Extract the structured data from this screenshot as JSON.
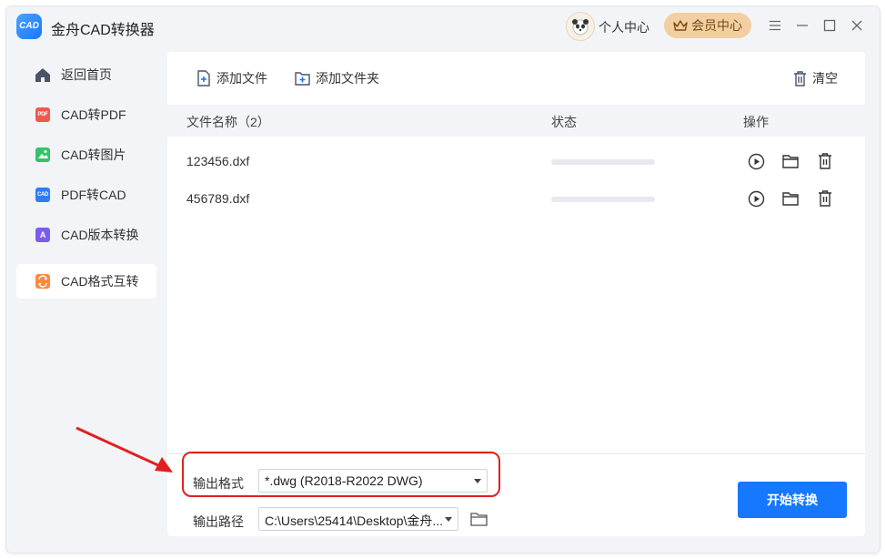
{
  "app": {
    "logo_text": "CAD",
    "title": "金舟CAD转换器"
  },
  "header": {
    "user_center": "个人中心",
    "vip_center": "会员中心"
  },
  "sidebar": {
    "items": [
      {
        "label": "返回首页",
        "icon": "home-icon"
      },
      {
        "label": "CAD转PDF",
        "icon": "pdf-icon",
        "badge": "PDF",
        "color": "#f0594f"
      },
      {
        "label": "CAD转图片",
        "icon": "image-icon",
        "color": "#36c26b"
      },
      {
        "label": "PDF转CAD",
        "icon": "cad-icon",
        "badge": "CAD",
        "color": "#2d7df6"
      },
      {
        "label": "CAD版本转换",
        "icon": "version-icon",
        "badge": "A",
        "color": "#7a5cf0"
      },
      {
        "label": "CAD格式互转",
        "icon": "format-icon",
        "color": "#ff8a3d",
        "active": true
      }
    ]
  },
  "toolbar": {
    "add_file": "添加文件",
    "add_folder": "添加文件夹",
    "clear": "清空"
  },
  "table": {
    "col_name": "文件名称（2）",
    "col_status": "状态",
    "col_action": "操作",
    "rows": [
      {
        "name": "123456.dxf",
        "progress": 0
      },
      {
        "name": "456789.dxf",
        "progress": 0
      }
    ]
  },
  "output": {
    "format_label": "输出格式",
    "format_value": "*.dwg (R2018-R2022 DWG)",
    "path_label": "输出路径",
    "path_value": "C:\\Users\\25414\\Desktop\\金舟..."
  },
  "start_button": "开始转换",
  "colors": {
    "accent": "#1677ff",
    "annotation": "#e02020",
    "vip": "#f2cfa2"
  }
}
